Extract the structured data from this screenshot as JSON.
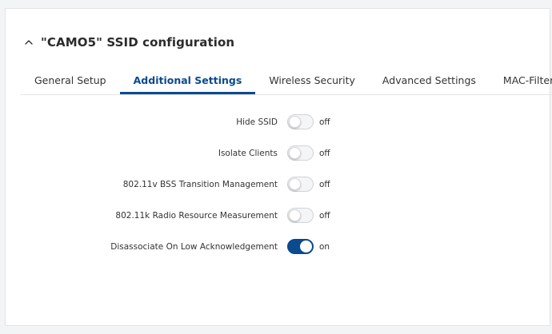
{
  "section": {
    "title": "\"CAMO5\" SSID configuration",
    "collapse_icon": "chevron-up-icon"
  },
  "tabs": [
    {
      "label": "General Setup",
      "active": false
    },
    {
      "label": "Additional Settings",
      "active": true
    },
    {
      "label": "Wireless Security",
      "active": false
    },
    {
      "label": "Advanced Settings",
      "active": false
    },
    {
      "label": "MAC-Filter",
      "active": false
    }
  ],
  "settings": [
    {
      "label": "Hide SSID",
      "state": "off"
    },
    {
      "label": "Isolate Clients",
      "state": "off"
    },
    {
      "label": "802.11v BSS Transition Management",
      "state": "off"
    },
    {
      "label": "802.11k Radio Resource Measurement",
      "state": "off"
    },
    {
      "label": "Disassociate On Low Acknowledgement",
      "state": "on"
    }
  ],
  "colors": {
    "accent": "#0b4a8f",
    "background": "#f3f4f6",
    "card": "#ffffff"
  }
}
